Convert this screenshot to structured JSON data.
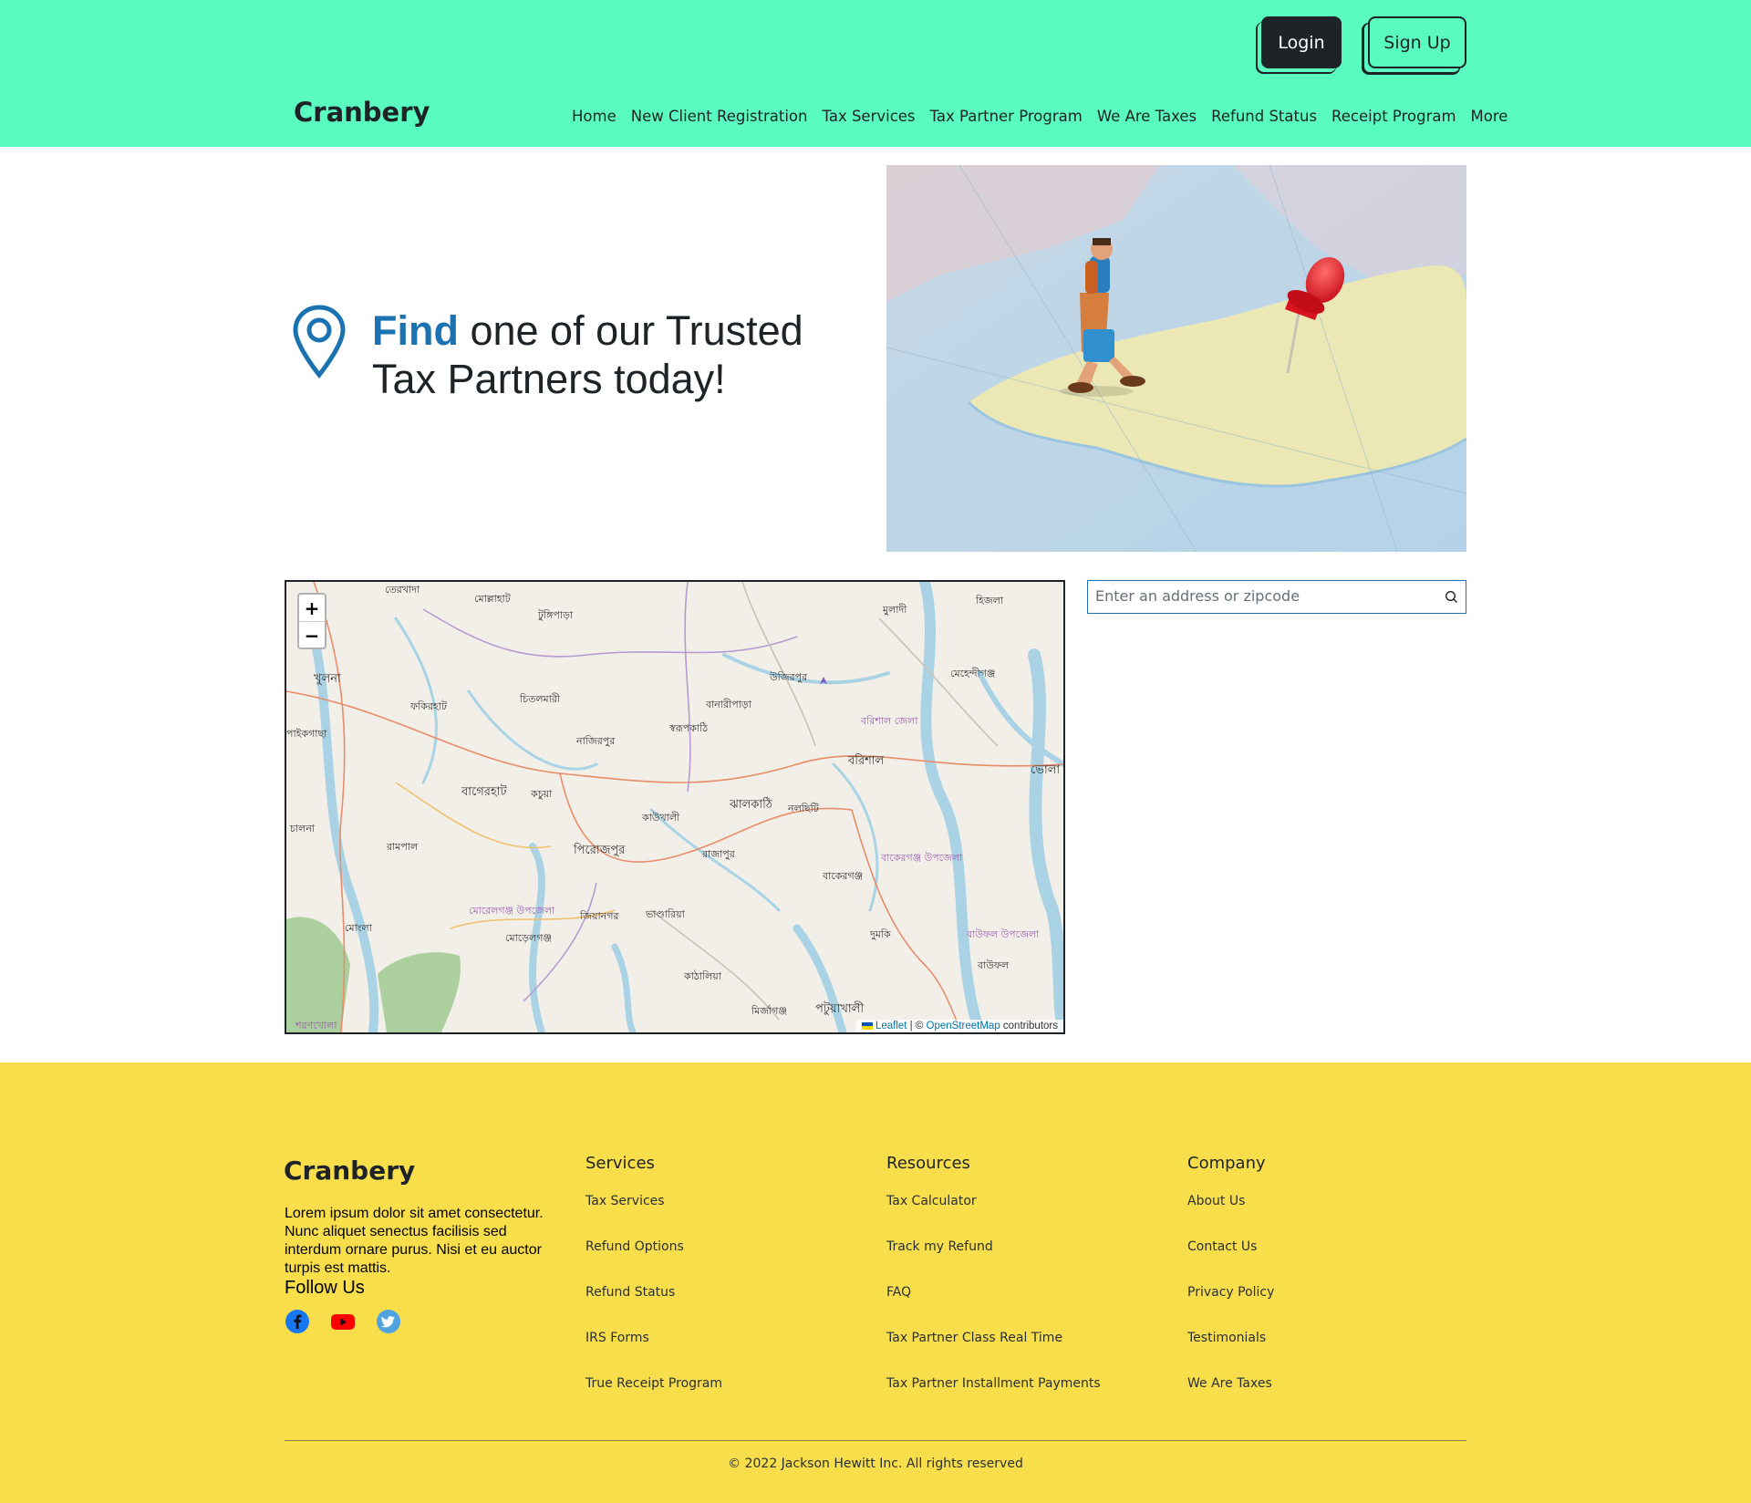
{
  "header": {
    "login_label": "Login",
    "signup_label": "Sign Up",
    "brand": "Cranbery",
    "nav": [
      "Home",
      "New Client Registration",
      "Tax Services",
      "Tax Partner Program",
      "We Are Taxes",
      "Refund Status",
      "Receipt Program",
      "More"
    ]
  },
  "hero": {
    "title_accent": "Find",
    "title_rest": " one of our Trusted Tax Partners today!",
    "icon": "location-pin-icon"
  },
  "map": {
    "zoom_in": "+",
    "zoom_out": "−",
    "attribution_leaflet": "Leaflet",
    "attribution_sep": " | © ",
    "attribution_osm": "OpenStreetMap",
    "attribution_tail": " contributors",
    "places": [
      "খুলনা",
      "ফকিরহাট",
      "চিতলমারী",
      "বাগেরহাট",
      "কচুয়া",
      "রামপাল",
      "মোংলা",
      "পিরোজপুর",
      "নাজিরপুর",
      "স্বরূপকাঠি",
      "বানারীপাড়া",
      "উজিরপুর",
      "বরিশাল",
      "বরিশাল জেলা",
      "ঝালকাঠি",
      "নলছিটি",
      "কাউখালী",
      "রাজাপুর",
      "ভাণ্ডারিয়া",
      "জিয়ানগর",
      "মোড়েলগঞ্জ",
      "কাঠালিয়া",
      "মির্জাগঞ্জ",
      "পটুয়াখালী",
      "বাকেরগঞ্জ",
      "দুমকি",
      "বাউফল",
      "ভোলা",
      "মেহেন্দীগঞ্জ",
      "হিজলা",
      "মুলাদী",
      "তেরখাদা",
      "মোল্লাহাট",
      "টুঙ্গিপাড়া",
      "চালনা",
      "মোরেলগঞ্জ উপজেলা",
      "বাকেরগঞ্জ উপজেলা",
      "বাউফল উপজেলা",
      "পাইকগাছা",
      "শরণখোলা"
    ]
  },
  "search": {
    "placeholder": "Enter an address or zipcode",
    "icon": "search-icon"
  },
  "footer": {
    "brand": "Cranbery",
    "description": "Lorem ipsum dolor sit amet consectetur. Nunc aliquet senectus facilisis sed interdum ornare purus. Nisi et eu auctor turpis est mattis.",
    "follow": "Follow Us",
    "socials": [
      "facebook-icon",
      "youtube-icon",
      "twitter-icon"
    ],
    "columns": [
      {
        "heading": "Services",
        "links": [
          "Tax Services",
          "Refund Options",
          "Refund Status",
          "IRS Forms",
          "True Receipt Program"
        ]
      },
      {
        "heading": "Resources",
        "links": [
          "Tax Calculator",
          "Track my Refund",
          "FAQ",
          "Tax Partner Class Real Time",
          "Tax Partner Installment Payments"
        ]
      },
      {
        "heading": "Company",
        "links": [
          "About Us",
          "Contact Us",
          "Privacy Policy",
          "Testimonials",
          "We Are Taxes"
        ]
      }
    ],
    "copyright": "© 2022 Jackson Hewitt Inc. All rights reserved"
  },
  "colors": {
    "header_bg": "#59fbbf",
    "footer_bg": "#f9de4b",
    "accent": "#1b72b0",
    "dark": "#1d2327"
  }
}
